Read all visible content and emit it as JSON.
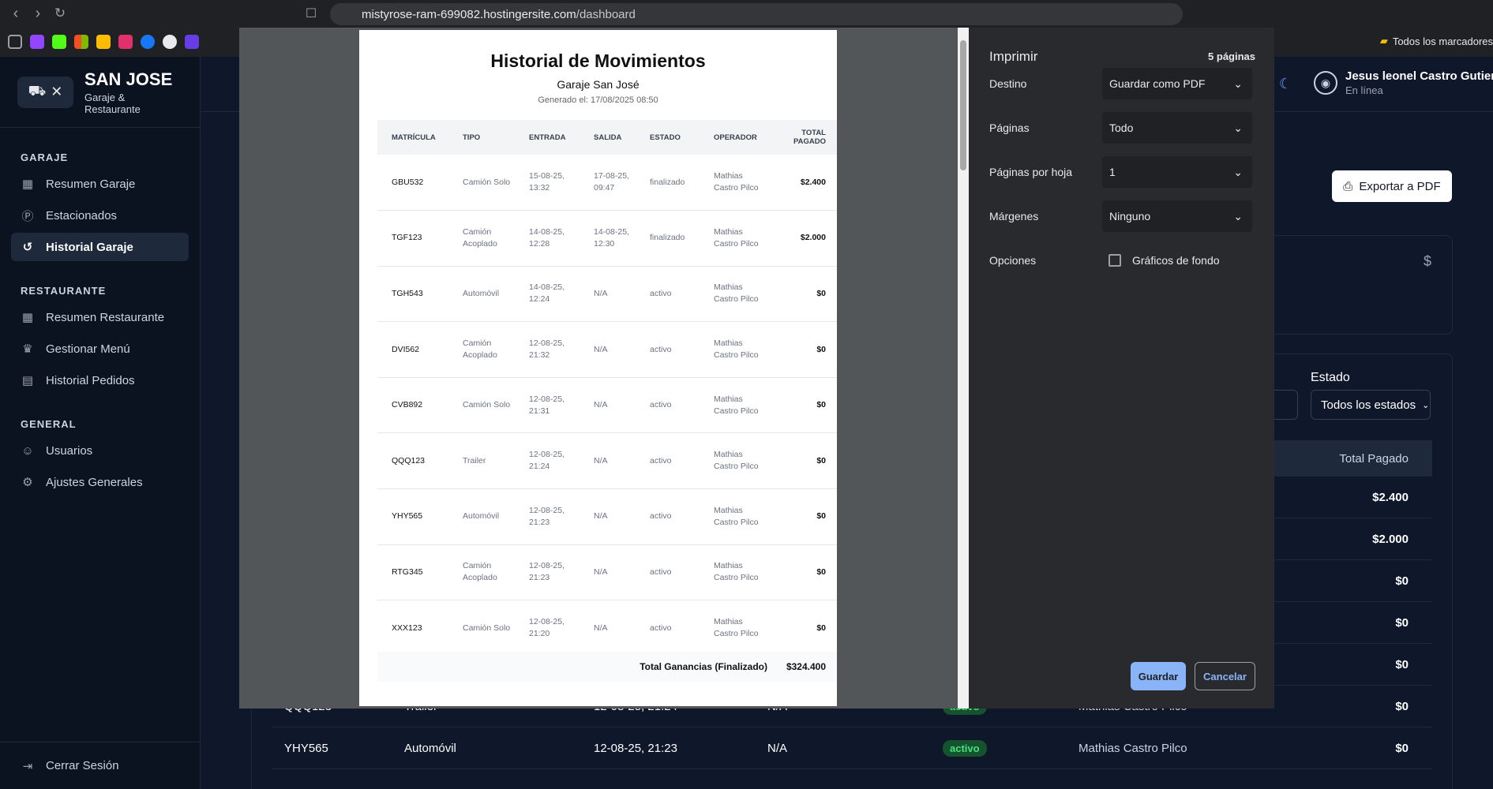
{
  "browser": {
    "url_domain": "mistyrose-ram-699082.hostingersite.com",
    "url_path": "/dashboard",
    "bookmark_folder": "Todos los marcadores"
  },
  "sidebar": {
    "brand_name": "SAN JOSE",
    "brand_sub": "Garaje & Restaurante",
    "sections": [
      {
        "title": "GARAJE",
        "items": [
          {
            "label": "Resumen Garaje",
            "icon": "grid-icon"
          },
          {
            "label": "Estacionados",
            "icon": "parking-icon"
          },
          {
            "label": "Historial Garaje",
            "icon": "history-icon",
            "active": true
          }
        ]
      },
      {
        "title": "RESTAURANTE",
        "items": [
          {
            "label": "Resumen Restaurante",
            "icon": "grid-icon"
          },
          {
            "label": "Gestionar Menú",
            "icon": "chef-hat-icon"
          },
          {
            "label": "Historial Pedidos",
            "icon": "clipboard-icon"
          }
        ]
      },
      {
        "title": "GENERAL",
        "items": [
          {
            "label": "Usuarios",
            "icon": "users-icon"
          },
          {
            "label": "Ajustes Generales",
            "icon": "gear-icon"
          }
        ]
      }
    ],
    "logout": "Cerrar Sesión"
  },
  "header": {
    "user_name": "Jesus leonel Castro Gutierre",
    "user_status": "En línea"
  },
  "main": {
    "export_label": "Exportar a PDF",
    "currency_symbol": "$",
    "estado_label": "Estado",
    "estado_value": "Todos los estados",
    "total_header": "Total Pagado",
    "row_totals": [
      "$2.400",
      "$2.000",
      "$0",
      "$0",
      "$0",
      "$0",
      "$0"
    ],
    "visible_rows": [
      {
        "plate": "QQQ123",
        "type": "Trailer",
        "entry": "12-08-25, 21:24",
        "exit": "N/A",
        "status": "activo",
        "operator": "Mathias Castro Pilco",
        "total": "$0"
      },
      {
        "plate": "YHY565",
        "type": "Automóvil",
        "entry": "12-08-25, 21:23",
        "exit": "N/A",
        "status": "activo",
        "operator": "Mathias Castro Pilco",
        "total": "$0"
      }
    ]
  },
  "print_dialog": {
    "title": "Imprimir",
    "page_count": "5 páginas",
    "destino_label": "Destino",
    "destino_value": "Guardar como PDF",
    "paginas_label": "Páginas",
    "paginas_value": "Todo",
    "por_hoja_label": "Páginas por hoja",
    "por_hoja_value": "1",
    "margenes_label": "Márgenes",
    "margenes_value": "Ninguno",
    "opciones_label": "Opciones",
    "graficos_label": "Gráficos de fondo",
    "save_label": "Guardar",
    "cancel_label": "Cancelar"
  },
  "document": {
    "title": "Historial de Movimientos",
    "subtitle": "Garaje San José",
    "generated": "Generado el: 17/08/2025 08:50",
    "columns": [
      "MATRÍCULA",
      "TIPO",
      "ENTRADA",
      "SALIDA",
      "ESTADO",
      "OPERADOR",
      "TOTAL PAGADO"
    ],
    "rows": [
      [
        "GBU532",
        "Camión Solo",
        "15-08-25, 13:32",
        "17-08-25, 09:47",
        "finalizado",
        "Mathias Castro Pilco",
        "$2.400"
      ],
      [
        "TGF123",
        "Camión Acoplado",
        "14-08-25, 12:28",
        "14-08-25, 12:30",
        "finalizado",
        "Mathias Castro Pilco",
        "$2.000"
      ],
      [
        "TGH543",
        "Automóvil",
        "14-08-25, 12:24",
        "N/A",
        "activo",
        "Mathias Castro Pilco",
        "$0"
      ],
      [
        "DVI562",
        "Camión Acoplado",
        "12-08-25, 21:32",
        "N/A",
        "activo",
        "Mathias Castro Pilco",
        "$0"
      ],
      [
        "CVB892",
        "Camión Solo",
        "12-08-25, 21:31",
        "N/A",
        "activo",
        "Mathias Castro Pilco",
        "$0"
      ],
      [
        "QQQ123",
        "Trailer",
        "12-08-25, 21:24",
        "N/A",
        "activo",
        "Mathias Castro Pilco",
        "$0"
      ],
      [
        "YHY565",
        "Automóvil",
        "12-08-25, 21:23",
        "N/A",
        "activo",
        "Mathias Castro Pilco",
        "$0"
      ],
      [
        "RTG345",
        "Camión Acoplado",
        "12-08-25, 21:23",
        "N/A",
        "activo",
        "Mathias Castro Pilco",
        "$0"
      ],
      [
        "XXX123",
        "Camión Solo",
        "12-08-25, 21:20",
        "N/A",
        "activo",
        "Mathias Castro Pilco",
        "$0"
      ]
    ],
    "total_label": "Total Ganancias (Finalizado)",
    "total_value": "$324.400"
  },
  "colors": {
    "app_bg": "#0f172a",
    "sidebar_bg": "#0b1220",
    "accent_blue": "#8ab4f8",
    "status_green": "#4ade80"
  }
}
